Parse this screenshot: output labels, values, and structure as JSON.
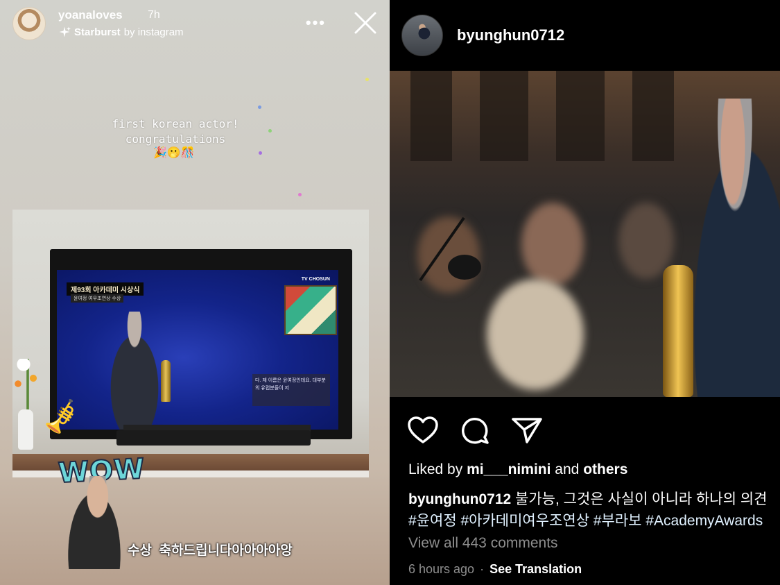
{
  "story": {
    "username": "yoanaloves",
    "time_ago": "7h",
    "effect_name": "Starburst",
    "effect_by": "by instagram",
    "caption_line1": "first korean actor!",
    "caption_line2": "congratulations",
    "caption_emojis": "🎉🫢🎊",
    "tv": {
      "title": "제93회 아카데미 시상식",
      "subtitle": "윤여정 여우조연상 수상",
      "channel": "TV CHOSUN",
      "subtitle_caption": "다. 제 이름은 윤여정인데요. 대부분의 유럽분들이 저"
    },
    "sticker_wow": "WOW",
    "sticker_text": "수상  축하드립니다아아아아앙",
    "icons": {
      "more": "more-horizontal-icon",
      "close": "close-icon",
      "effect": "sparkle-icon"
    }
  },
  "post": {
    "username": "byunghun0712",
    "likes_prefix": "Liked by",
    "likes_user": "mi___nimini",
    "likes_and": "and",
    "likes_others": "others",
    "caption_user": "byunghun0712",
    "caption_text": "불가능, 그것은 사실이 아니라 하나의 의견",
    "hashtags": "#윤여정 #아카데미여우조연상 #부라보 #AcademyAwards",
    "view_comments": "View all 443 comments",
    "time_ago": "6 hours ago",
    "separator": "·",
    "see_translation": "See Translation",
    "icons": {
      "like": "heart-icon",
      "comment": "comment-icon",
      "share": "send-icon"
    }
  },
  "colors": {
    "post_background": "#000000",
    "hashtag": "#e0f1ff",
    "muted_text": "#8e8e8e",
    "wow_sticker": "#6dd6d9"
  }
}
